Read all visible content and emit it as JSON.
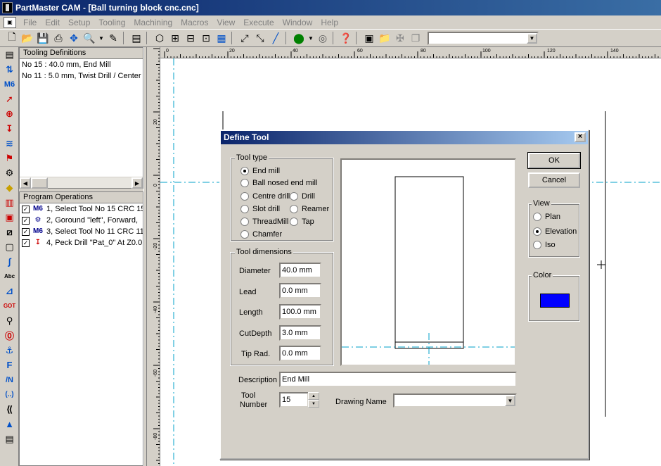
{
  "app": {
    "title": "PartMaster CAM - [Ball turning block cnc.cnc]",
    "menu": [
      "File",
      "Edit",
      "Setup",
      "Tooling",
      "Machining",
      "Macros",
      "View",
      "Execute",
      "Window",
      "Help"
    ]
  },
  "toolbar": {
    "icons": [
      "new-file-icon",
      "open-folder-icon",
      "save-icon",
      "print-icon",
      "pan-icon",
      "zoom-icon",
      "dropdown-arrow-icon",
      "pencil-icon",
      "calculator-icon",
      "cube-icon",
      "view-3d-icon",
      "view-2d-icon",
      "view-side-icon",
      "grid-icon",
      "measure-icon",
      "measure-2-icon",
      "line-icon",
      "run-icon",
      "dropdown-arrow-icon",
      "stop-icon",
      "help-icon",
      "layers-icon",
      "folder-open-icon",
      "transform-icon",
      "copy-icon"
    ],
    "combo_value": ""
  },
  "tooling_definitions": {
    "header": "Tooling Definitions",
    "items": [
      "No 15 : 40.0 mm, End Mill",
      "No 11 : 5.0 mm, Twist Drill / Center D"
    ]
  },
  "program_operations": {
    "header": "Program Operations",
    "items": [
      {
        "icon": "M6",
        "text": "1, Select Tool No 15 CRC 15"
      },
      {
        "icon": "turn-icon",
        "text": "2, Goround \"left\", Forward,"
      },
      {
        "icon": "M6",
        "text": "3, Select Tool No 11 CRC 11"
      },
      {
        "icon": "drill-icon",
        "text": "4, Peck Drill \"Pat_0\" At Z0.0"
      }
    ]
  },
  "rulers": {
    "horizontal": [
      "0",
      "20",
      "40",
      "60",
      "80",
      "100",
      "120",
      "140"
    ],
    "vertical": [
      "20",
      "0",
      "-20",
      "-40",
      "-60",
      "-80"
    ]
  },
  "dialog": {
    "title": "Define Tool",
    "close": "×",
    "tool_type": {
      "label": "Tool type",
      "options": [
        "End mill",
        "Ball nosed end mill",
        "Centre drill",
        "Drill",
        "Slot drill",
        "Reamer",
        "ThreadMill",
        "Tap",
        "Chamfer"
      ],
      "selected": "End mill"
    },
    "dimensions": {
      "label": "Tool dimensions",
      "fields": [
        {
          "label": "Diameter",
          "value": "40.0 mm"
        },
        {
          "label": "Lead",
          "value": "0.0 mm"
        },
        {
          "label": "Length",
          "value": "100.0 mm"
        },
        {
          "label": "CutDepth",
          "value": "3.0 mm"
        },
        {
          "label": "Tip Rad.",
          "value": "0.0 mm"
        }
      ]
    },
    "ok_label": "OK",
    "cancel_label": "Cancel",
    "view": {
      "label": "View",
      "options": [
        "Plan",
        "Elevation",
        "Iso"
      ],
      "selected": "Elevation"
    },
    "color": {
      "label": "Color",
      "value": "#0000ff"
    },
    "description": {
      "label": "Description",
      "value": "End Mill"
    },
    "tool_number": {
      "label_line1": "Tool",
      "label_line2": "Number",
      "value": "15"
    },
    "drawing_name": {
      "label": "Drawing Name",
      "value": ""
    }
  },
  "left_tools": [
    "document-icon",
    "axis-icon",
    "M6",
    "arrow-icon",
    "crosshair-icon",
    "drill-icon",
    "spring-icon",
    "flag-icon",
    "machine-icon",
    "diamond-icon",
    "film-icon",
    "camera-icon",
    "ruler-icon",
    "frame-icon",
    "curve-icon",
    "abc-icon",
    "axes-icon",
    "gotmacro-icon",
    "tap-icon",
    "stop-icon",
    "anchor-icon",
    "F",
    "/N",
    "(..)",
    "shape-icon",
    "triangle-icon"
  ]
}
